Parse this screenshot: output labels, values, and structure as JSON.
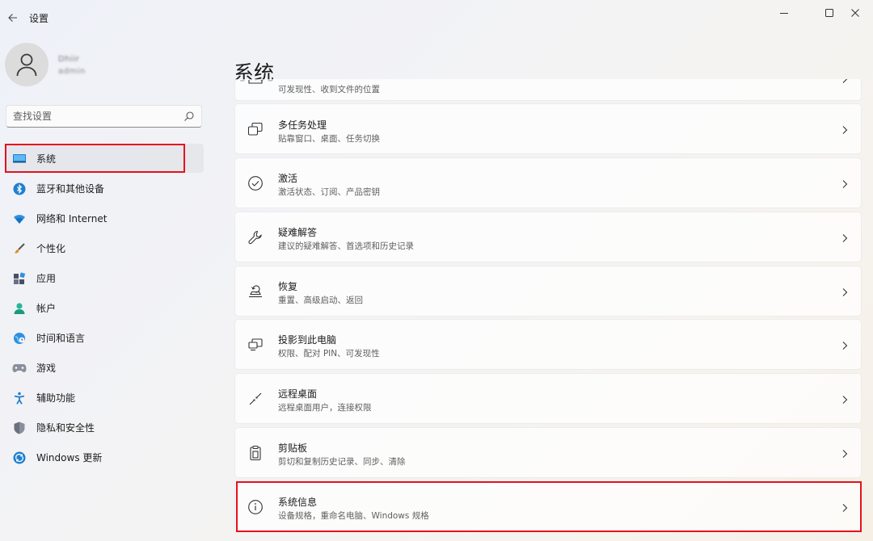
{
  "window": {
    "title": "设置"
  },
  "user": {
    "name": "Dhiir",
    "subtitle": "admin"
  },
  "search": {
    "placeholder": "查找设置"
  },
  "sidebar": {
    "items": [
      {
        "label": "系统",
        "icon": "monitor-icon"
      },
      {
        "label": "蓝牙和其他设备",
        "icon": "bluetooth-icon"
      },
      {
        "label": "网络和 Internet",
        "icon": "wifi-icon"
      },
      {
        "label": "个性化",
        "icon": "brush-icon"
      },
      {
        "label": "应用",
        "icon": "apps-icon"
      },
      {
        "label": "帐户",
        "icon": "account-icon"
      },
      {
        "label": "时间和语言",
        "icon": "globe-clock-icon"
      },
      {
        "label": "游戏",
        "icon": "gamepad-icon"
      },
      {
        "label": "辅助功能",
        "icon": "accessibility-icon"
      },
      {
        "label": "隐私和安全性",
        "icon": "shield-icon"
      },
      {
        "label": "Windows 更新",
        "icon": "update-icon"
      }
    ]
  },
  "main": {
    "title": "系统",
    "rows": [
      {
        "title": "",
        "subtitle": "可发现性、收到文件的位置",
        "icon": "nearby-sharing-icon"
      },
      {
        "title": "多任务处理",
        "subtitle": "贴靠窗口、桌面、任务切换",
        "icon": "multitask-icon"
      },
      {
        "title": "激活",
        "subtitle": "激活状态、订阅、产品密钥",
        "icon": "check-circle-icon"
      },
      {
        "title": "疑难解答",
        "subtitle": "建议的疑难解答、首选项和历史记录",
        "icon": "wrench-icon"
      },
      {
        "title": "恢复",
        "subtitle": "重置、高级启动、返回",
        "icon": "recovery-icon"
      },
      {
        "title": "投影到此电脑",
        "subtitle": "权限、配对 PIN、可发现性",
        "icon": "project-icon"
      },
      {
        "title": "远程桌面",
        "subtitle": "远程桌面用户，连接权限",
        "icon": "remote-desktop-icon"
      },
      {
        "title": "剪贴板",
        "subtitle": "剪切和复制历史记录、同步、清除",
        "icon": "clipboard-icon"
      },
      {
        "title": "系统信息",
        "subtitle": "设备规格，重命名电脑、Windows 规格",
        "icon": "info-icon"
      }
    ]
  },
  "colors": {
    "highlight": "#e4121d",
    "accent": "#0067c0"
  }
}
